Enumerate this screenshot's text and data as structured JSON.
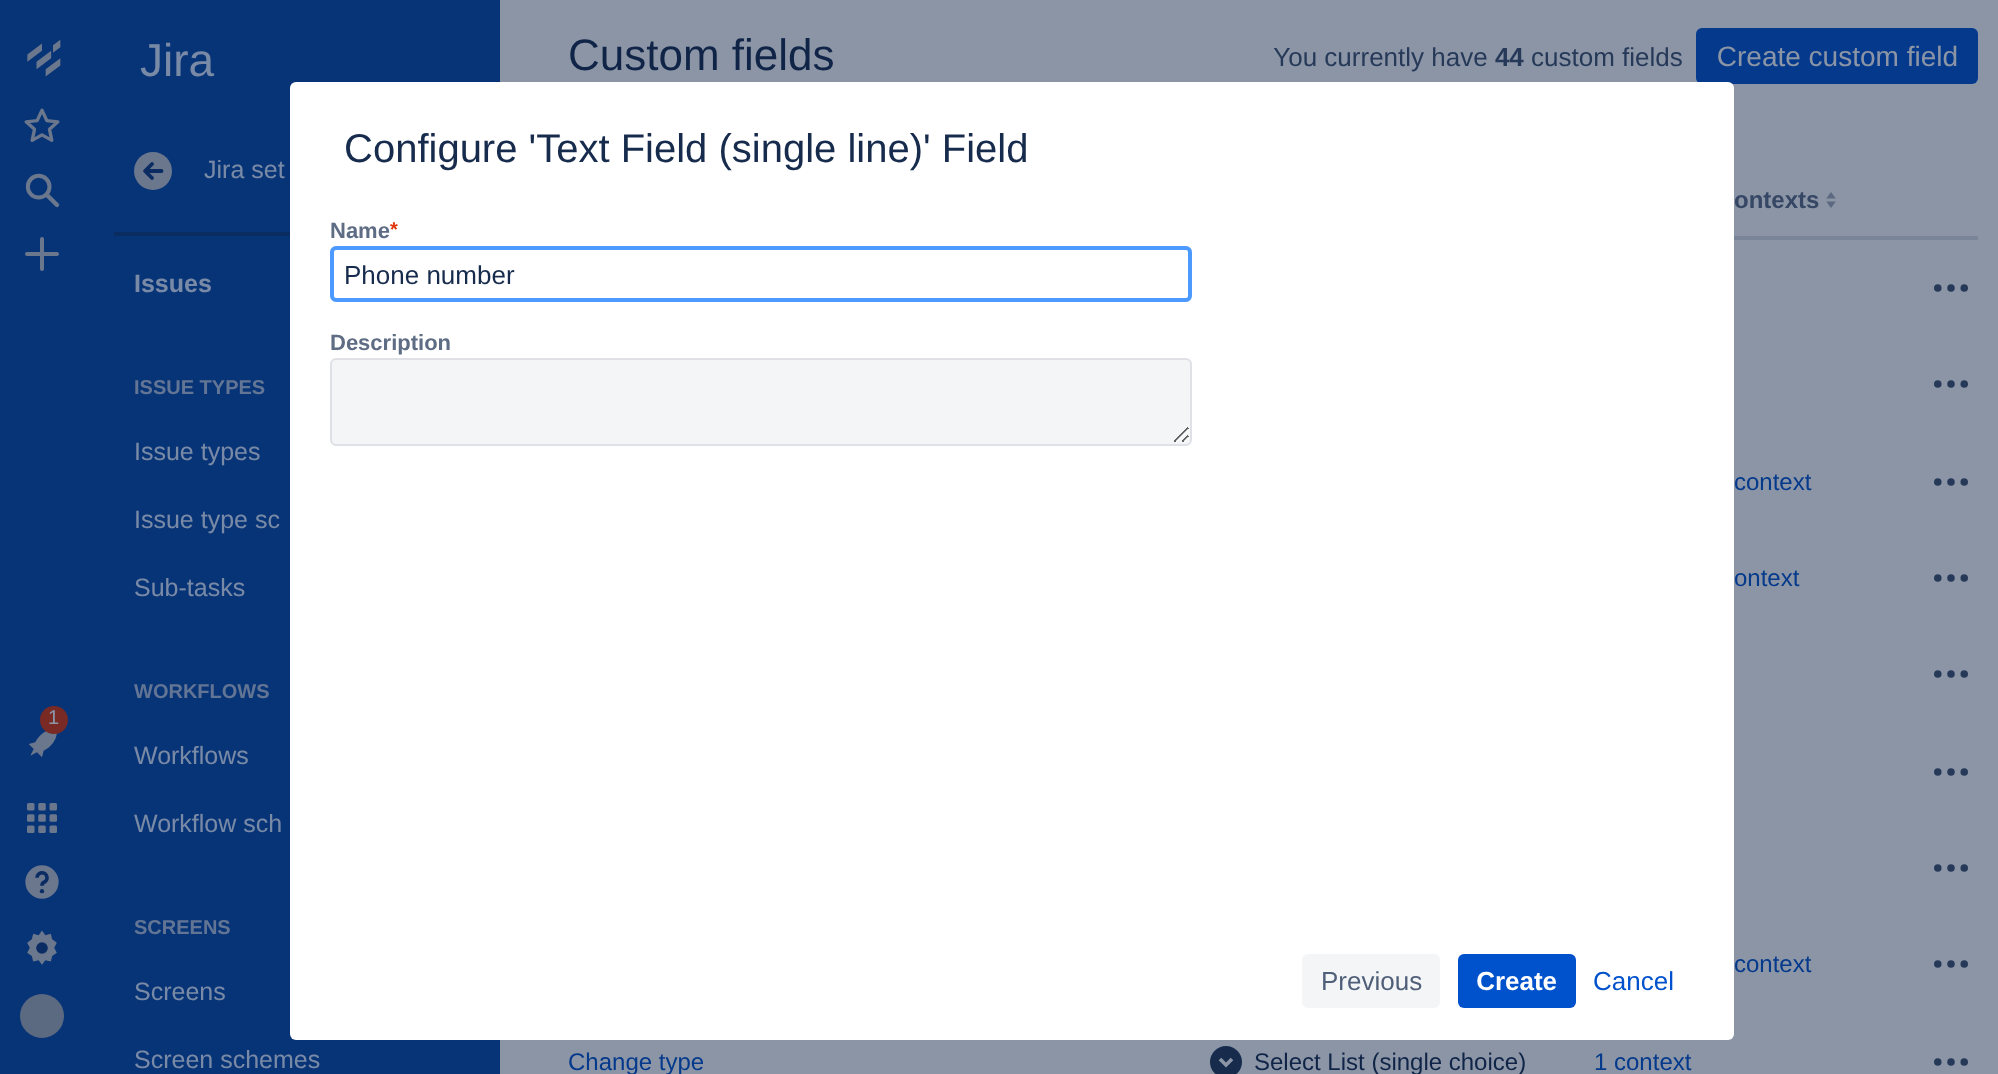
{
  "global_nav": {
    "notification_count": "1"
  },
  "sidebar": {
    "title": "Jira",
    "back_label": "Jira set",
    "items": [
      {
        "kind": "group",
        "label": "Issues"
      },
      {
        "kind": "heading",
        "label": "ISSUE TYPES"
      },
      {
        "kind": "link",
        "label": "Issue types"
      },
      {
        "kind": "link",
        "label": "Issue type sc"
      },
      {
        "kind": "link",
        "label": "Sub-tasks"
      },
      {
        "kind": "heading",
        "label": "WORKFLOWS"
      },
      {
        "kind": "link",
        "label": "Workflows"
      },
      {
        "kind": "link",
        "label": "Workflow sch"
      },
      {
        "kind": "heading",
        "label": "SCREENS"
      },
      {
        "kind": "link",
        "label": "Screens"
      },
      {
        "kind": "link",
        "label": "Screen schemes"
      }
    ]
  },
  "page": {
    "title": "Custom fields",
    "count_text": "You currently have **44** custom fields",
    "create_button": "Create custom field",
    "table": {
      "column_header": "ontexts",
      "rows": [
        {},
        {},
        {
          "under_dialog": true,
          "contexts": "context"
        },
        {
          "under_dialog": true,
          "contexts": "ontext"
        },
        {},
        {},
        {},
        {
          "under_dialog": true,
          "contexts": "context"
        },
        {
          "under_dialog": false,
          "action": "Change type",
          "type": "Select List (single choice)",
          "contexts": "1 context"
        }
      ]
    }
  },
  "dialog": {
    "title": "Configure 'Text Field (single line)' Field",
    "fields": [
      {
        "kind": "input",
        "label": "Name",
        "required_mark": "*",
        "value": "Phone number",
        "focused": true
      },
      {
        "kind": "textarea",
        "label": "Description",
        "focused": false
      }
    ],
    "buttons": [
      {
        "kind": "secondary",
        "label": "Previous"
      },
      {
        "kind": "primary",
        "label": "Create"
      },
      {
        "kind": "link",
        "label": "Cancel"
      }
    ]
  }
}
